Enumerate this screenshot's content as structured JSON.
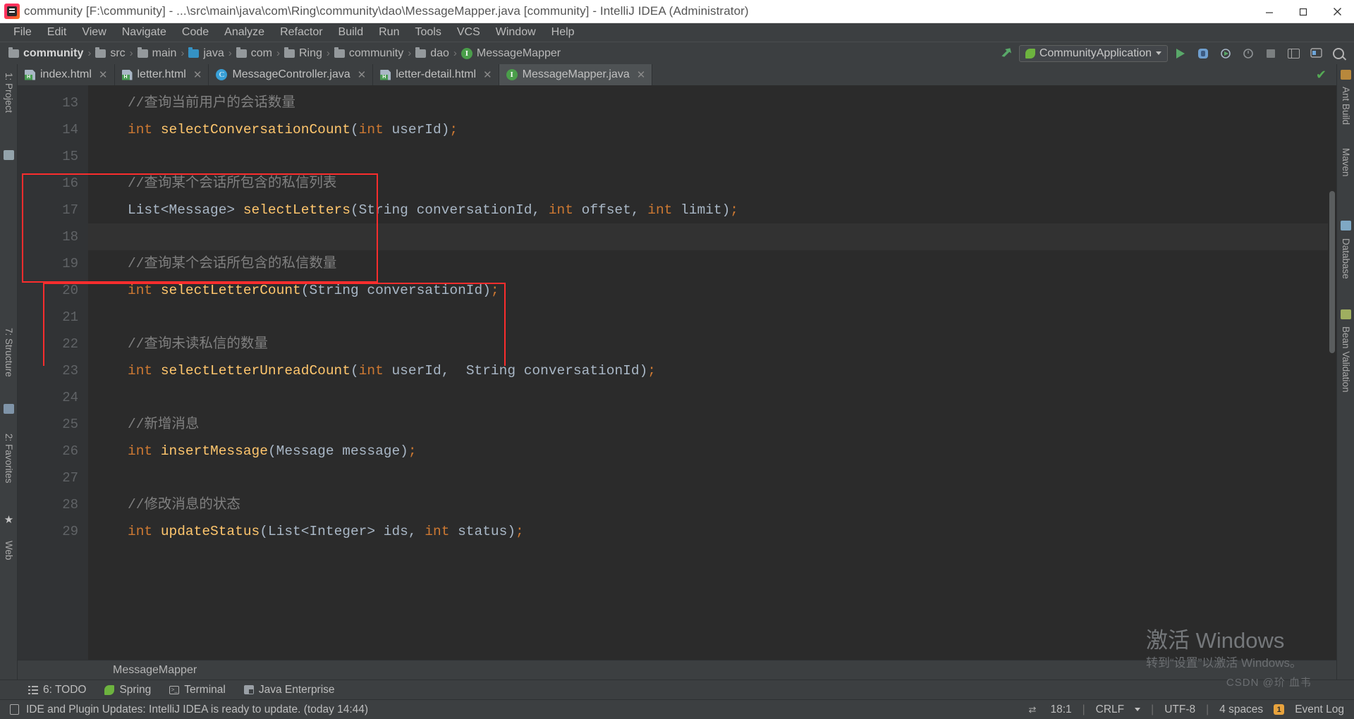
{
  "window": {
    "title": "community [F:\\community] - ...\\src\\main\\java\\com\\Ring\\community\\dao\\MessageMapper.java [community] - IntelliJ IDEA (Administrator)",
    "app_icon": "intellij-idea-icon",
    "minimize": "—",
    "maximize": "❐",
    "close": "✕"
  },
  "menu": {
    "items": [
      {
        "label": "File",
        "mnemonic": "F"
      },
      {
        "label": "Edit",
        "mnemonic": "E"
      },
      {
        "label": "View",
        "mnemonic": "V"
      },
      {
        "label": "Navigate",
        "mnemonic": "N"
      },
      {
        "label": "Code",
        "mnemonic": "C"
      },
      {
        "label": "Analyze",
        "mnemonic": "z"
      },
      {
        "label": "Refactor",
        "mnemonic": "R"
      },
      {
        "label": "Build",
        "mnemonic": "B"
      },
      {
        "label": "Run",
        "mnemonic": "u"
      },
      {
        "label": "Tools",
        "mnemonic": "T"
      },
      {
        "label": "VCS",
        "mnemonic": "S"
      },
      {
        "label": "Window",
        "mnemonic": "W"
      },
      {
        "label": "Help",
        "mnemonic": "H"
      }
    ]
  },
  "breadcrumb": {
    "separator": "›",
    "items": [
      {
        "label": "community",
        "icon": "folder-icon",
        "bold": true
      },
      {
        "label": "src",
        "icon": "folder-icon",
        "bold": false
      },
      {
        "label": "main",
        "icon": "folder-icon",
        "bold": false
      },
      {
        "label": "java",
        "icon": "folder-source-icon",
        "bold": false
      },
      {
        "label": "com",
        "icon": "folder-icon",
        "bold": false
      },
      {
        "label": "Ring",
        "icon": "folder-icon",
        "bold": false
      },
      {
        "label": "community",
        "icon": "folder-icon",
        "bold": false
      },
      {
        "label": "dao",
        "icon": "folder-icon",
        "bold": false
      },
      {
        "label": "MessageMapper",
        "icon": "interface-icon",
        "bold": false
      }
    ]
  },
  "toolbar": {
    "build_icon": "hammer-icon",
    "run_config": "CommunityApplication",
    "run_config_icon": "spring-boot-icon",
    "run_icon": "run-icon",
    "debug_icon": "debug-icon",
    "run_coverage_icon": "run-with-coverage-icon",
    "profile_icon": "profiler-icon",
    "stop_icon": "stop-icon",
    "layout_icon": "layout-icon",
    "updates_icon": "updates-icon",
    "search_icon": "search-everywhere-icon"
  },
  "tabs": [
    {
      "label": "index.html",
      "icon": "html-file-icon",
      "active": false,
      "close": "✕"
    },
    {
      "label": "letter.html",
      "icon": "html-file-icon",
      "active": false,
      "close": "✕"
    },
    {
      "label": "MessageController.java",
      "icon": "java-class-icon",
      "icon_letter": "C",
      "active": false,
      "close": "✕"
    },
    {
      "label": "letter-detail.html",
      "icon": "html-file-icon",
      "active": false,
      "close": "✕"
    },
    {
      "label": "MessageMapper.java",
      "icon": "java-interface-icon",
      "icon_letter": "I",
      "active": true,
      "close": "✕"
    }
  ],
  "inspection_status": "✔",
  "editor": {
    "first_line": 13,
    "lines": [
      {
        "num": 13,
        "segments": [
          {
            "t": "//查询当前用户的会话数量",
            "c": "cmt"
          }
        ]
      },
      {
        "num": 14,
        "segments": [
          {
            "t": "int",
            "c": "kw"
          },
          {
            "t": " ",
            "c": "pun"
          },
          {
            "t": "selectConversationCount",
            "c": "mth"
          },
          {
            "t": "(",
            "c": "pun"
          },
          {
            "t": "int",
            "c": "kw"
          },
          {
            "t": " userId",
            "c": "typ"
          },
          {
            "t": ")",
            "c": "pun"
          },
          {
            "t": ";",
            "c": "kw"
          }
        ]
      },
      {
        "num": 15,
        "segments": []
      },
      {
        "num": 16,
        "segments": [
          {
            "t": "//查询某个会话所包含的私信列表",
            "c": "cmt"
          }
        ]
      },
      {
        "num": 17,
        "segments": [
          {
            "t": "List<Message>",
            "c": "typ"
          },
          {
            "t": " ",
            "c": "pun"
          },
          {
            "t": "selectLetters",
            "c": "mth"
          },
          {
            "t": "(",
            "c": "pun"
          },
          {
            "t": "String conversationId",
            "c": "typ"
          },
          {
            "t": ", ",
            "c": "pun"
          },
          {
            "t": "int",
            "c": "kw"
          },
          {
            "t": " offset",
            "c": "typ"
          },
          {
            "t": ", ",
            "c": "pun"
          },
          {
            "t": "int",
            "c": "kw"
          },
          {
            "t": " limit",
            "c": "typ"
          },
          {
            "t": ")",
            "c": "pun"
          },
          {
            "t": ";",
            "c": "kw"
          }
        ]
      },
      {
        "num": 18,
        "segments": [],
        "current": true
      },
      {
        "num": 19,
        "segments": [
          {
            "t": "//查询某个会话所包含的私信数量",
            "c": "cmt"
          }
        ]
      },
      {
        "num": 20,
        "segments": [
          {
            "t": "int",
            "c": "kw"
          },
          {
            "t": " ",
            "c": "pun"
          },
          {
            "t": "selectLetterCount",
            "c": "mth"
          },
          {
            "t": "(",
            "c": "pun"
          },
          {
            "t": "String conversationId",
            "c": "typ"
          },
          {
            "t": ")",
            "c": "pun"
          },
          {
            "t": ";",
            "c": "kw"
          }
        ]
      },
      {
        "num": 21,
        "segments": []
      },
      {
        "num": 22,
        "segments": [
          {
            "t": "//查询未读私信的数量",
            "c": "cmt"
          }
        ]
      },
      {
        "num": 23,
        "segments": [
          {
            "t": "int",
            "c": "kw"
          },
          {
            "t": " ",
            "c": "pun"
          },
          {
            "t": "selectLetterUnreadCount",
            "c": "mth"
          },
          {
            "t": "(",
            "c": "pun"
          },
          {
            "t": "int",
            "c": "kw"
          },
          {
            "t": " userId",
            "c": "typ"
          },
          {
            "t": ",  ",
            "c": "pun"
          },
          {
            "t": "String conversationId",
            "c": "typ"
          },
          {
            "t": ")",
            "c": "pun"
          },
          {
            "t": ";",
            "c": "kw"
          }
        ]
      },
      {
        "num": 24,
        "segments": []
      },
      {
        "num": 25,
        "segments": [
          {
            "t": "//新增消息",
            "c": "cmt"
          }
        ]
      },
      {
        "num": 26,
        "segments": [
          {
            "t": "int",
            "c": "kw"
          },
          {
            "t": " ",
            "c": "pun"
          },
          {
            "t": "insertMessage",
            "c": "mth"
          },
          {
            "t": "(",
            "c": "pun"
          },
          {
            "t": "Message message",
            "c": "typ"
          },
          {
            "t": ")",
            "c": "pun"
          },
          {
            "t": ";",
            "c": "kw"
          }
        ]
      },
      {
        "num": 27,
        "segments": []
      },
      {
        "num": 28,
        "segments": [
          {
            "t": "//修改消息的状态",
            "c": "cmt"
          }
        ]
      },
      {
        "num": 29,
        "segments": [
          {
            "t": "int",
            "c": "kw"
          },
          {
            "t": " ",
            "c": "pun"
          },
          {
            "t": "updateStatus",
            "c": "mth"
          },
          {
            "t": "(",
            "c": "pun"
          },
          {
            "t": "List<Integer> ids",
            "c": "typ"
          },
          {
            "t": ", ",
            "c": "pun"
          },
          {
            "t": "int",
            "c": "kw"
          },
          {
            "t": " status",
            "c": "typ"
          },
          {
            "t": ")",
            "c": "pun"
          },
          {
            "t": ";",
            "c": "kw"
          }
        ]
      }
    ],
    "breadcrumb_footer": "MessageMapper",
    "annotations": [
      {
        "name": "insert-message-highlight",
        "color": "#fb2d2d"
      },
      {
        "name": "update-status-highlight",
        "color": "#fb2d2d"
      }
    ]
  },
  "left_tool_strips": [
    {
      "label": "1: Project",
      "icon": "project-icon"
    },
    {
      "label": "7: Structure",
      "icon": "structure-icon"
    },
    {
      "label": "2: Favorites",
      "icon": "favorites-icon"
    },
    {
      "label": "Web",
      "icon": "web-icon"
    }
  ],
  "right_tool_strips": [
    {
      "label": "Ant Build",
      "icon": "ant-icon"
    },
    {
      "label": "Maven",
      "icon": "maven-icon"
    },
    {
      "label": "Database",
      "icon": "database-icon"
    },
    {
      "label": "Bean Validation",
      "icon": "bean-validation-icon"
    }
  ],
  "bottom_tool_windows": [
    {
      "label": "6: TODO",
      "mnemonic": "6",
      "icon": "todo-icon"
    },
    {
      "label": "Spring",
      "icon": "spring-icon"
    },
    {
      "label": "Terminal",
      "icon": "terminal-icon"
    },
    {
      "label": "Java Enterprise",
      "icon": "java-enterprise-icon"
    }
  ],
  "statusbar": {
    "message": "IDE and Plugin Updates: IntelliJ IDEA is ready to update. (today 14:44)",
    "message_icon": "notification-icon",
    "caret_position": "18:1",
    "line_separator": "CRLF",
    "encoding": "UTF-8",
    "indent": "4 spaces",
    "git_icon": "branch-icon",
    "event_log": "Event Log",
    "event_log_badge": "1"
  },
  "watermark": {
    "line1": "激活 Windows",
    "line2": "转到“设置”以激活 Windows。",
    "credit": "CSDN @玠 血韦"
  },
  "colors": {
    "accent_red": "#fb2d2d",
    "keyword": "#cc7832",
    "method": "#ffc66d",
    "comment": "#808080",
    "text": "#a9b7c6",
    "editor_bg": "#2b2b2b",
    "chrome_bg": "#3c3f41"
  }
}
